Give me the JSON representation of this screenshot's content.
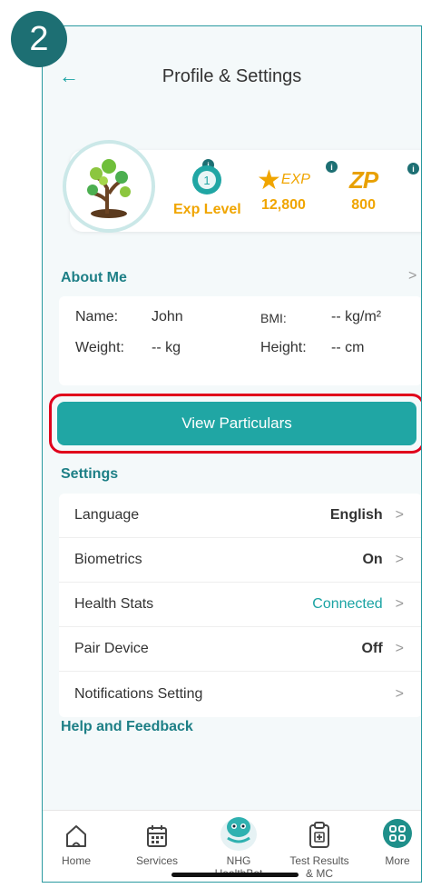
{
  "step": "2",
  "header": {
    "title": "Profile & Settings",
    "back_icon": "arrow-left-icon"
  },
  "stats": [
    {
      "label": "Exp Level",
      "value": "",
      "icon": "level-badge-icon"
    },
    {
      "label": "EXP",
      "value": "12,800",
      "icon": "star-exp-icon"
    },
    {
      "label": "ZP",
      "value": "800",
      "icon": "zp-icon"
    }
  ],
  "about": {
    "title": "About Me",
    "name_label": "Name:",
    "name_value": "John",
    "bmi_label": "BMI:",
    "bmi_value": "-- kg/m²",
    "weight_label": "Weight:",
    "weight_value": "-- kg",
    "height_label": "Height:",
    "height_value": "-- cm"
  },
  "view_particulars": "View Particulars",
  "settings": {
    "title": "Settings",
    "items": [
      {
        "label": "Language",
        "value": "English"
      },
      {
        "label": "Biometrics",
        "value": "On"
      },
      {
        "label": "Health Stats",
        "value": "Connected"
      },
      {
        "label": "Pair Device",
        "value": "Off"
      },
      {
        "label": "Notifications Setting",
        "value": ""
      }
    ]
  },
  "help_title": "Help and Feedback",
  "tabs": [
    {
      "label": "Home",
      "icon": "home-icon"
    },
    {
      "label": "Services",
      "icon": "calendar-icon"
    },
    {
      "label": "NHG HealthBot",
      "icon": "healthbot-icon"
    },
    {
      "label": "Test Results & MC",
      "icon": "clipboard-icon"
    },
    {
      "label": "More",
      "icon": "grid-icon"
    }
  ],
  "colors": {
    "accent": "#20a6a4",
    "gold": "#f0a500",
    "highlight": "#e0001b",
    "badge": "#1d6f73"
  }
}
